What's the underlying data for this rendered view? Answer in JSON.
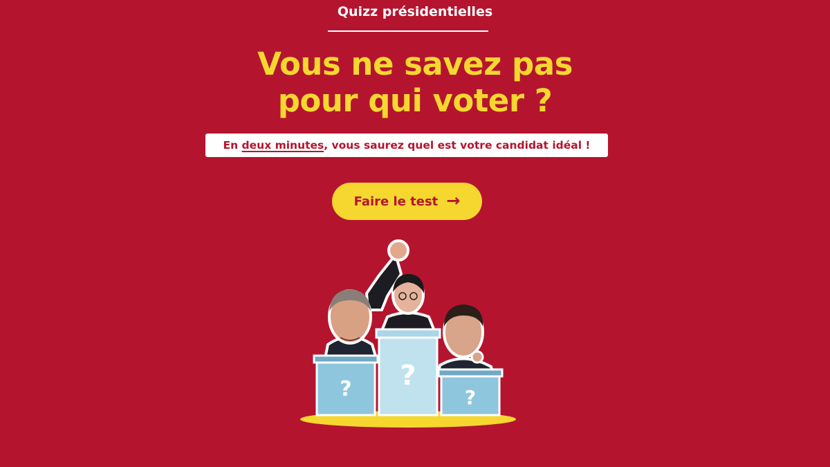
{
  "header": {
    "eyebrow": "Quizz présidentielles"
  },
  "hero": {
    "headline_line1": "Vous ne savez pas",
    "headline_line2": "pour qui voter ?",
    "subtitle_before": "En ",
    "subtitle_emphasis": "deux minutes",
    "subtitle_after": ", vous saurez quel est votre candidat idéal !"
  },
  "cta": {
    "label": "Faire le test"
  },
  "illustration": {
    "podium_marks": [
      "?",
      "?",
      "?"
    ]
  },
  "colors": {
    "background": "#B5142F",
    "accent_yellow": "#F5D730",
    "podium_blue": "#8EC6DE",
    "white": "#FFFFFF"
  }
}
